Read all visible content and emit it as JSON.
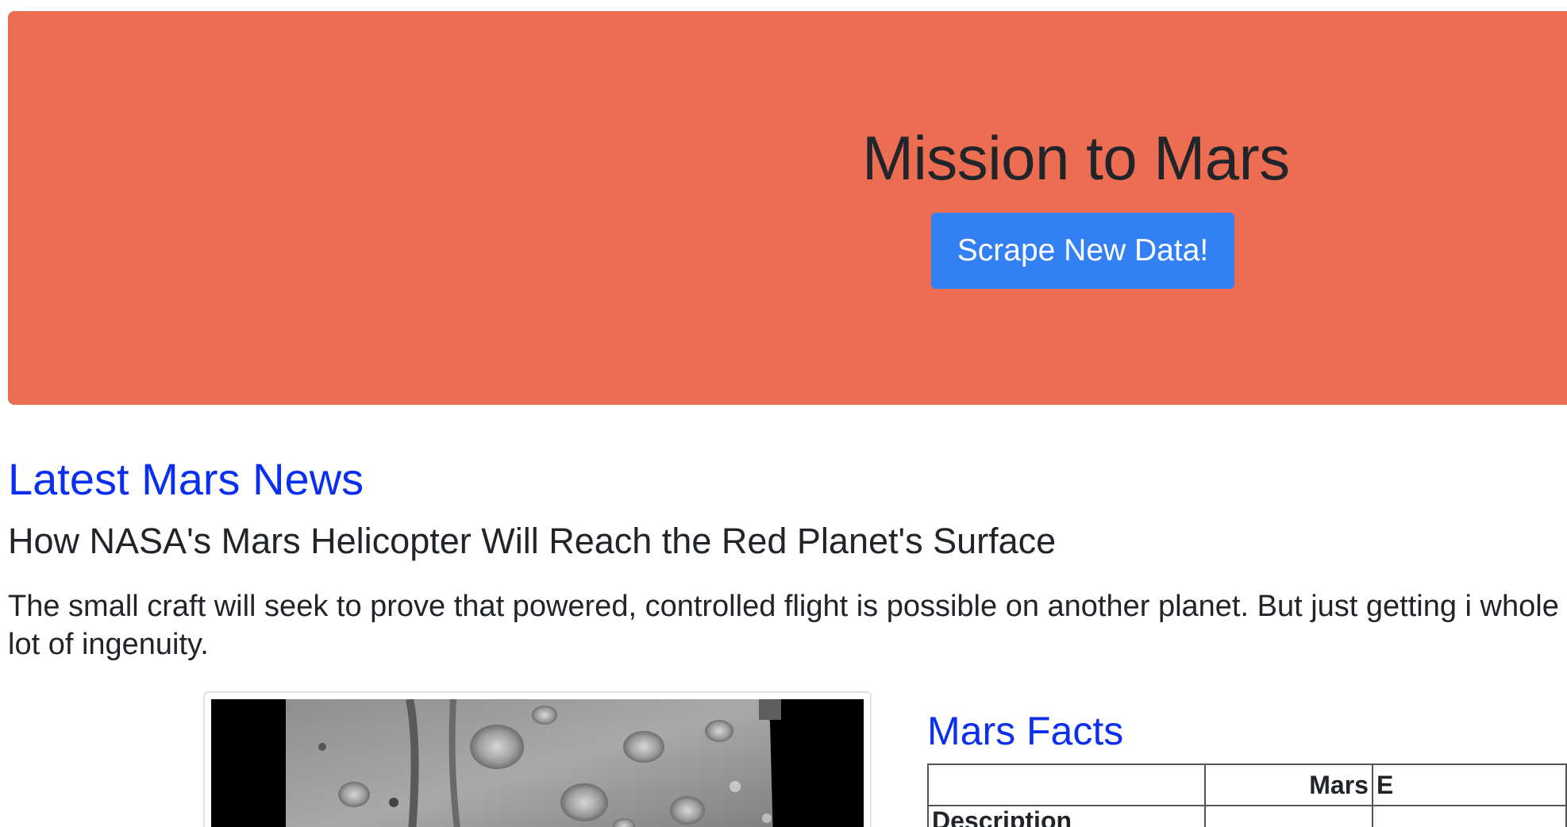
{
  "jumbotron": {
    "title": "Mission to Mars",
    "button_label": "Scrape New Data!",
    "background_color": "#ec6d51",
    "button_color": "#3380f5"
  },
  "news": {
    "heading": "Latest Mars News",
    "title": "How NASA's Mars Helicopter Will Reach the Red Planet's Surface",
    "paragraph": "The small craft will seek to prove that powered, controlled flight is possible on another planet. But just getting i whole lot of ingenuity."
  },
  "featured_image": {
    "icon": "mars-surface-image"
  },
  "facts": {
    "heading": "Mars Facts",
    "columns": [
      "",
      "Mars",
      "E"
    ],
    "rows": [
      {
        "label": "Description",
        "values": [
          "",
          ""
        ]
      }
    ]
  },
  "colors": {
    "heading_link": "#0a2ff0",
    "text": "#212529"
  }
}
